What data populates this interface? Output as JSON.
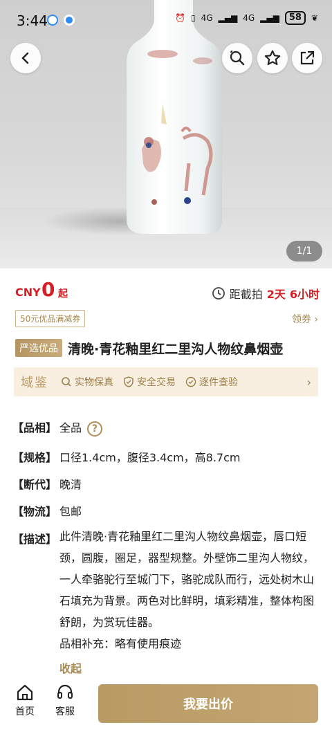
{
  "status_bar": {
    "time": "3:44",
    "signal_1": "4G",
    "signal_2": "4G",
    "battery": "58"
  },
  "gallery": {
    "counter": "1/1"
  },
  "price": {
    "currency": "CNY",
    "amount": "0",
    "suffix": "起"
  },
  "countdown": {
    "label": "距截拍",
    "days": "2天",
    "hours": "6小时"
  },
  "coupon": {
    "tag": "50元优品满减券",
    "action": "领券"
  },
  "title": {
    "badge": "严选优品",
    "text": "清晚·青花釉里红二里沟人物纹鼻烟壶"
  },
  "guarantee": {
    "brand": "域鉴",
    "items": [
      "实物保真",
      "安全交易",
      "逐件查验"
    ]
  },
  "specs": {
    "condition": {
      "key": "【品相】",
      "value": "全品",
      "help": "?"
    },
    "size": {
      "key": "【规格】",
      "value": "口径1.4cm，腹径3.4cm，高8.7cm"
    },
    "era": {
      "key": "【断代】",
      "value": "晚清"
    },
    "shipping": {
      "key": "【物流】",
      "value": "包邮"
    },
    "desc": {
      "key": "【描述】",
      "value": "此件清晚·青花釉里红二里沟人物纹鼻烟壶，唇口短颈，圆腹，圈足，器型规整。外壁饰二里沟人物纹，一人牵骆驼行至城门下，骆驼成队而行，远处树木山石填充为背景。两色对比鲜明，填彩精准，整体构图舒朗，为赏玩佳器。",
      "supplement": "品相补充：略有使用痕迹",
      "collapse": "收起"
    }
  },
  "bottom_bar": {
    "home": "首页",
    "service": "客服",
    "bid": "我要出价"
  },
  "colors": {
    "accent_gold": "#b89a63",
    "price_red": "#d41f24"
  }
}
